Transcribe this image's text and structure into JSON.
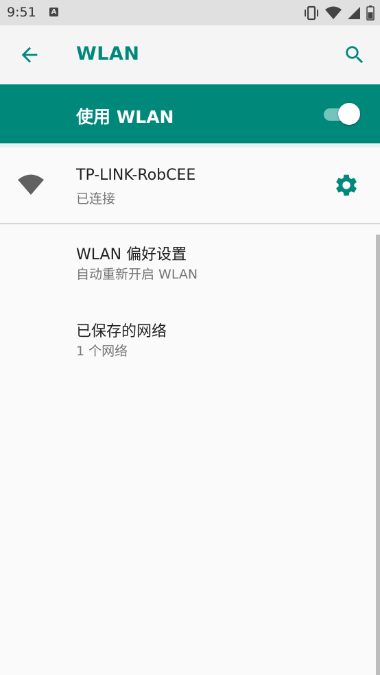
{
  "status_bar": {
    "time": "9:51",
    "notification_icon": "a-letter-icon",
    "icons": [
      "vibrate-icon",
      "wifi-signal-icon",
      "cell-signal-icon",
      "battery-icon"
    ]
  },
  "toolbar": {
    "title": "WLAN",
    "back_icon": "arrow-back-icon",
    "search_icon": "search-icon"
  },
  "master_switch": {
    "label": "使用 WLAN",
    "state": "on"
  },
  "connected_network": {
    "name": "TP-LINK-RobCEE",
    "status": "已连接",
    "icon": "wifi-icon",
    "settings_icon": "gear-icon"
  },
  "preferences": [
    {
      "title": "WLAN 偏好设置",
      "summary": "自动重新开启 WLAN"
    },
    {
      "title": "已保存的网络",
      "summary": "1 个网络"
    }
  ],
  "colors": {
    "accent": "#00897b",
    "toolbar_bg": "#f5f5f5",
    "status_bar_bg": "#e0e0e0",
    "page_bg": "#fafafa"
  }
}
